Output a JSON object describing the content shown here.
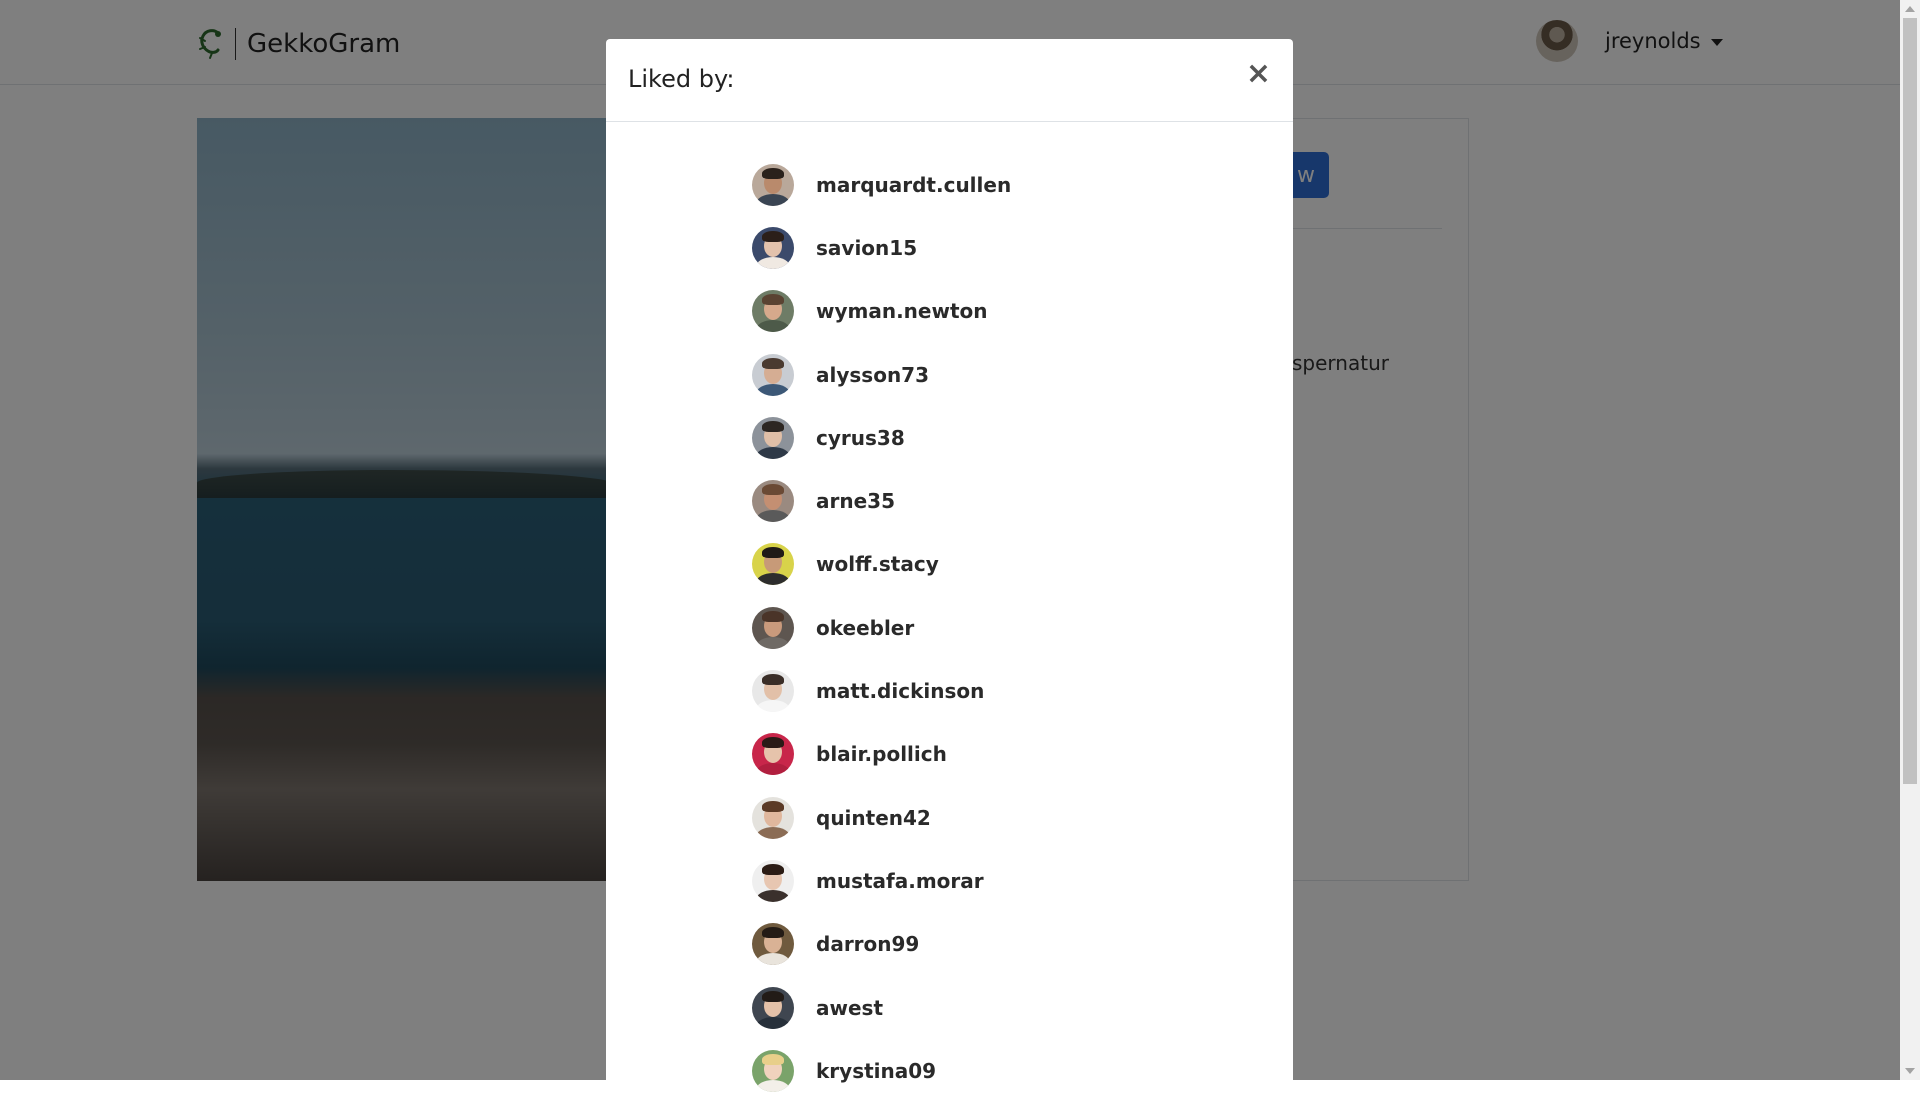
{
  "navbar": {
    "brand_name": "GekkoGram",
    "logo_icon": "gecko-logo-icon",
    "user": {
      "username": "jreynolds"
    }
  },
  "post": {
    "follow_label": "w",
    "caption_fragment": "spernatur"
  },
  "modal": {
    "title": "Liked by:",
    "close_label": "×",
    "likes": [
      {
        "username": "marquardt.cullen",
        "bg": "#b9a89a",
        "skin": "#b98a6c",
        "hair": "#2a211b",
        "shirt": "#3a4553"
      },
      {
        "username": "savion15",
        "bg": "#3b4a6b",
        "skin": "#e3c2ac",
        "hair": "#2b1f1a",
        "shirt": "#f0e9e2"
      },
      {
        "username": "wyman.newton",
        "bg": "#6e7c66",
        "skin": "#d6a98c",
        "hair": "#5a4332",
        "shirt": "#4d5a49"
      },
      {
        "username": "alysson73",
        "bg": "#c8ccd2",
        "skin": "#d5ad93",
        "hair": "#4a3a30",
        "shirt": "#3c5877"
      },
      {
        "username": "cyrus38",
        "bg": "#8c929a",
        "skin": "#e0bfa7",
        "hair": "#2c2622",
        "shirt": "#2e3947"
      },
      {
        "username": "arne35",
        "bg": "#9a8a80",
        "skin": "#c48f72",
        "hair": "#6a4a35",
        "shirt": "#5a5a5a"
      },
      {
        "username": "wolff.stacy",
        "bg": "#d8d34a",
        "skin": "#c79a78",
        "hair": "#1f1a17",
        "shirt": "#2d2d2d"
      },
      {
        "username": "okeebler",
        "bg": "#5e5650",
        "skin": "#c99a7c",
        "hair": "#4a3428",
        "shirt": "#6f6a65"
      },
      {
        "username": "matt.dickinson",
        "bg": "#e8e8e8",
        "skin": "#e2c0a8",
        "hair": "#3a2e28",
        "shirt": "#f6f6f6"
      },
      {
        "username": "blair.pollich",
        "bg": "#c8264a",
        "skin": "#e6c3ab",
        "hair": "#2a1a16",
        "shirt": "#b11f3f"
      },
      {
        "username": "quinten42",
        "bg": "#e4e2dd",
        "skin": "#e0b79d",
        "hair": "#5b3a26",
        "shirt": "#8b6c55"
      },
      {
        "username": "mustafa.morar",
        "bg": "#efefef",
        "skin": "#e7c6b1",
        "hair": "#2b1c15",
        "shirt": "#3a302c"
      },
      {
        "username": "darron99",
        "bg": "#6f5a3e",
        "skin": "#d9b295",
        "hair": "#231b15",
        "shirt": "#e9e4dc"
      },
      {
        "username": "awest",
        "bg": "#3f4650",
        "skin": "#e4c1a8",
        "hair": "#221b17",
        "shirt": "#27303a"
      },
      {
        "username": "krystina09",
        "bg": "#7aa36a",
        "skin": "#f0d2bd",
        "hair": "#e8cf8a",
        "shirt": "#f3efe9"
      }
    ]
  },
  "colors": {
    "primary_button": "#2f6fd6",
    "backdrop": "rgba(0,0,0,0.5)"
  }
}
